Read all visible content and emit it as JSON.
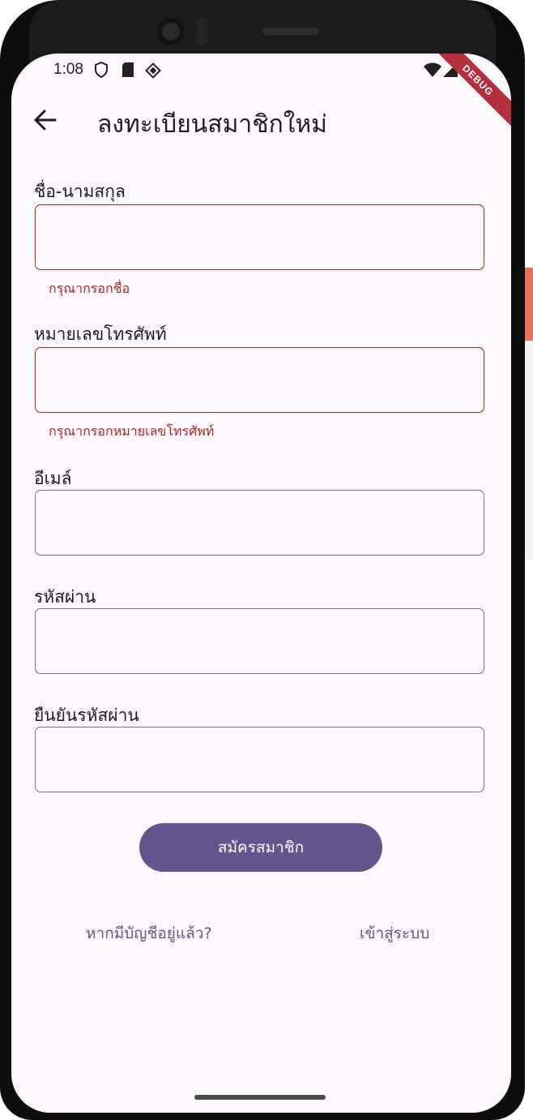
{
  "status_bar": {
    "time": "1:08",
    "debug_banner": "DEBUG"
  },
  "appbar": {
    "title": "ลงทะเบียนสมาชิกใหม่"
  },
  "form": {
    "name": {
      "label": "ชื่อ-นามสกุล",
      "value": "",
      "error": "กรุณากรอกชื่อ"
    },
    "phone": {
      "label": "หมายเลขโทรศัพท์",
      "value": "",
      "error": "กรุณากรอกหมายเลขโทรศัพท์"
    },
    "email": {
      "label": "อีเมล์",
      "value": ""
    },
    "password": {
      "label": "รหัสผ่าน",
      "value": ""
    },
    "confirm_password": {
      "label": "ยืนยันรหัสผ่าน",
      "value": ""
    }
  },
  "actions": {
    "register_label": "สมัครสมาชิก",
    "have_account_label": "หากมีบัญชีอยู่แล้ว?",
    "login_label": "เข้าสู่ระบบ"
  },
  "colors": {
    "background": "#fdf7fe",
    "primary": "#65558f",
    "error": "#b3261e",
    "outline": "#79747e"
  }
}
